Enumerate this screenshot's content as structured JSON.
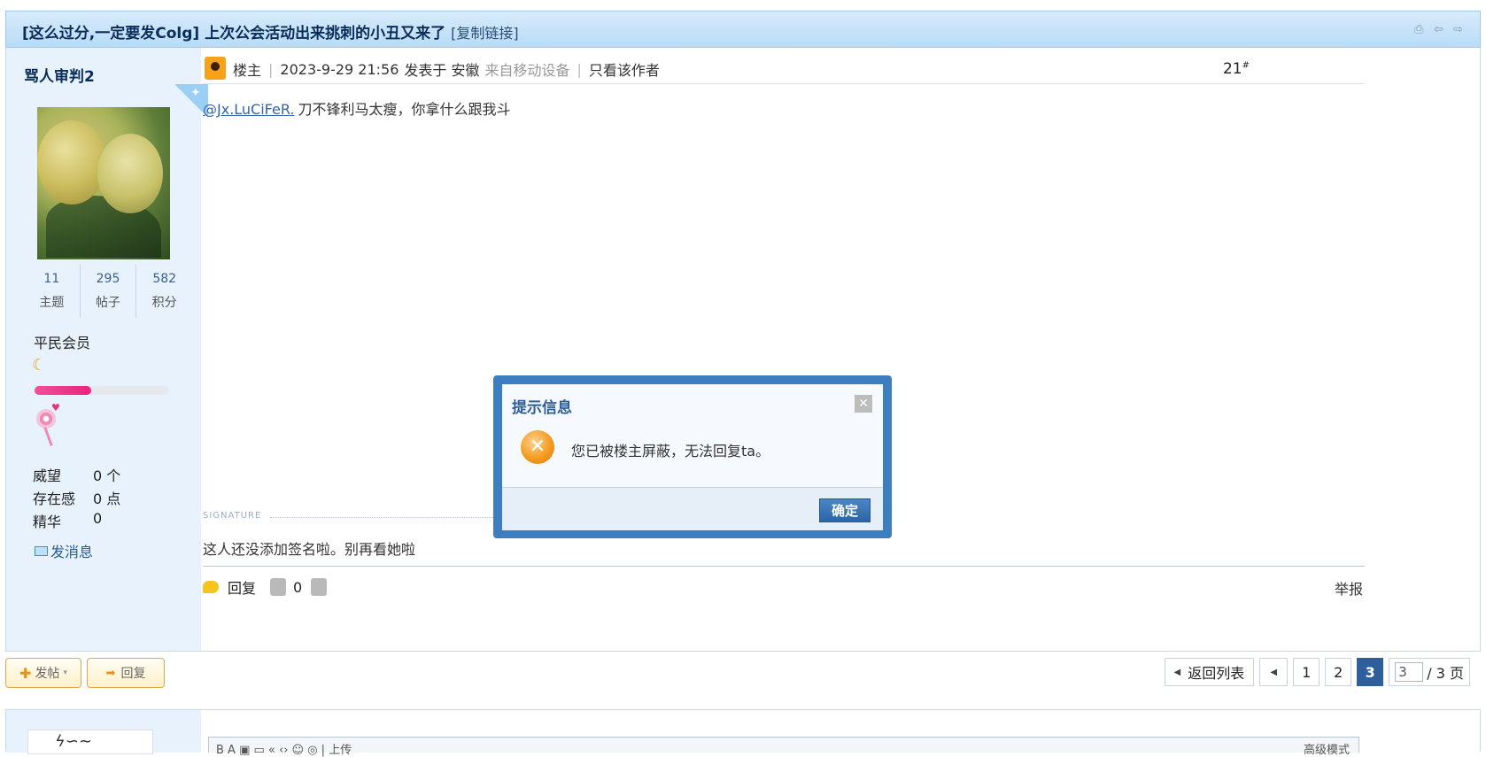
{
  "thread": {
    "title": "[这么过分,一定要发Colg] 上次公会活动出来挑刺的小丑又来了",
    "copy_link": "[复制链接]"
  },
  "author": {
    "name": "骂人审判2",
    "stats": [
      {
        "value": "11",
        "label": "主题"
      },
      {
        "value": "295",
        "label": "帖子"
      },
      {
        "value": "582",
        "label": "积分"
      }
    ],
    "level": "平民会员",
    "progress_fraction": 0.42,
    "info": [
      {
        "key": "威望",
        "value": "0 个"
      },
      {
        "key": "存在感",
        "value": "0 点"
      },
      {
        "key": "精华",
        "value": "0"
      }
    ],
    "send_message": "发消息"
  },
  "post": {
    "op_label": "楼主",
    "timestamp": "2023-9-29 21:56",
    "posted_in": "发表于 安徽",
    "device": "来自移动设备",
    "only_author": "只看该作者",
    "floor": "21",
    "floor_mark": "#",
    "mention": "@Jx.LuCiFeR.",
    "text": "刀不锋利马太瘦，你拿什么跟我斗",
    "signature_label": "SIGNATURE",
    "signature": "这人还没添加签名啦。别再看她啦",
    "reply": "回复",
    "likes": "0",
    "report": "举报"
  },
  "toolbar": {
    "new_post": "发帖",
    "reply": "回复"
  },
  "pager": {
    "back": "返回列表",
    "pages": [
      "1",
      "2",
      "3"
    ],
    "current": "3",
    "input_value": "3",
    "total": "/ 3 页"
  },
  "editor": {
    "toolbar_left": "B  A  ▣  ▭  «  ‹›  ☺  ◎  |  上传",
    "advanced": "高级模式"
  },
  "dialog": {
    "title": "提示信息",
    "message": "您已被楼主屏蔽，无法回复ta。",
    "ok": "确定"
  },
  "colors": {
    "accent": "#2f5f9a",
    "dialog_border": "#3d7ec1",
    "sidebar_bg": "#e7f2fd",
    "progress": "#e9247d"
  }
}
